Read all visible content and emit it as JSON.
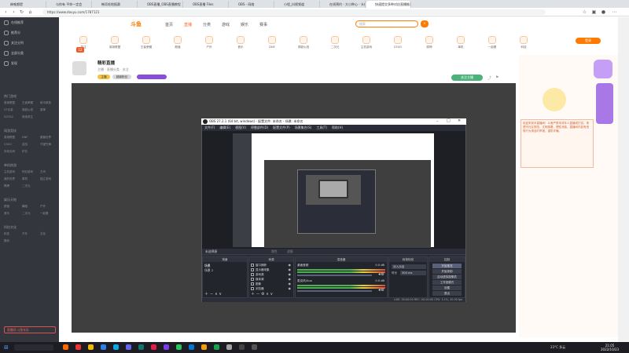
{
  "tabs": [
    {
      "label": "绅唯都提",
      "color": "#ff6a00"
    },
    {
      "label": "与你有 平你一定会",
      "color": "#ff6a00"
    },
    {
      "label": "韩项毛地报赛",
      "color": "#3b82f6"
    },
    {
      "label": "OBS直播_OBS直播教程",
      "color": "#16a34a"
    },
    {
      "label": "OBS直播 Files",
      "color": "#16a34a"
    },
    {
      "label": "OBS - 网络",
      "color": "#16a34a"
    },
    {
      "label": "小程_抖视频道",
      "color": "#7c3aed"
    },
    {
      "label": "在线预约 - 大小种心 - 头像",
      "color": "#dc2626"
    },
    {
      "label": "快速提交多种对应直播推荐_量什",
      "color": "#ff6a00"
    }
  ],
  "url": "https://www.douyu.com/1787121",
  "sidebar": {
    "top_items": [
      "在线推荐",
      "推荐分",
      "关注分列",
      "全部分类",
      "发现"
    ],
    "groups": [
      {
        "title": "热门游戏",
        "items": [
          "英雄联盟",
          "王者荣耀",
          "和平精英",
          "CF手游",
          "穿越火线",
          "原神",
          "DOTA2",
          "绝地求生"
        ]
      },
      {
        "title": "网游竞技",
        "items": [
          "英雄联盟",
          "DNF",
          "魔兽世界",
          "CSGO",
          "逆战",
          "守望先锋",
          "永劫无间",
          "炉石"
        ]
      },
      {
        "title": "单机热游",
        "items": [
          "主机游戏",
          "怀旧游戏",
          "方舟",
          "我的世界",
          "单机",
          "独立游戏",
          "棋牌",
          "二次元"
        ]
      },
      {
        "title": "娱乐天地",
        "items": [
          "颜值",
          "舞蹈",
          "户外",
          "音乐",
          "二次元",
          "一起看"
        ]
      },
      {
        "title": "科技文化",
        "items": [
          "科技",
          "汽车",
          "文化",
          "数码"
        ]
      }
    ],
    "footer": "直播间 斗鱼车队"
  },
  "header": {
    "logo": "斗鱼",
    "nav": [
      "首页",
      "直播",
      "分类",
      "游戏",
      "娱乐",
      "赛事"
    ],
    "nav_active": 1,
    "categories": [
      "关注",
      "英雄联盟",
      "王者荣耀",
      "颜值",
      "户外",
      "音乐",
      "DNF",
      "穿越火线",
      "二次元",
      "主机游戏",
      "CSGO",
      "原神",
      "单机",
      "一起看",
      "科技"
    ],
    "search_placeholder": "搜索",
    "user_button": "登录"
  },
  "room": {
    "title": "精彩直播",
    "meta": "主播 · 直播分类 · 关注",
    "tags": [
      "主播",
      "超级粉丝"
    ],
    "follow": "关注主播",
    "count": "12"
  },
  "obs": {
    "title": "OBS 27.2.1 (64 bit, windows) - 配置文件: 未命名 - 场景: 未命名",
    "menu": [
      "文件(F)",
      "编辑(E)",
      "视图(V)",
      "停靠部件(D)",
      "配置文件(P)",
      "场景集合(S)",
      "工具(T)",
      "帮助(H)"
    ],
    "preview_label": "未选择源",
    "prop_btn": "属性",
    "filter_btn": "滤镜",
    "docks": {
      "scenes": "场景",
      "sources": "来源",
      "mixer": "混音器",
      "transitions": "转场特效",
      "controls": "控制"
    },
    "scene_items": [
      "场景",
      "场景 2"
    ],
    "source_items": [
      "窗口捕获",
      "显示器采集",
      "游戏源",
      "媒体源",
      "图像",
      "浏览器"
    ],
    "mixer_tracks": [
      "桌面音频",
      "麦克风/Aux"
    ],
    "mixer_levels": [
      "0.0 dB",
      "0.0 dB"
    ],
    "transition": "淡入淡出",
    "duration_label": "时长",
    "duration": "300 ms",
    "controls": [
      "开始推流",
      "开始录制",
      "启动虚拟摄像机",
      "工作室模式",
      "设置",
      "退出"
    ],
    "status": "LIVE: 00:00:00  REC: 00:00:00  CPU: 3.1%, 30.00 fps"
  },
  "chat_notice": "欢迎来到本直播间！斗鱼严禁未成年人直播或打赏。请遵守社区规范，文明观看，理性消费。直播间内如有违规行为请及时举报，谨防诈骗。",
  "taskbar": {
    "weather": "23°C 多云",
    "time": "21:05",
    "date": "2022/10/23"
  }
}
